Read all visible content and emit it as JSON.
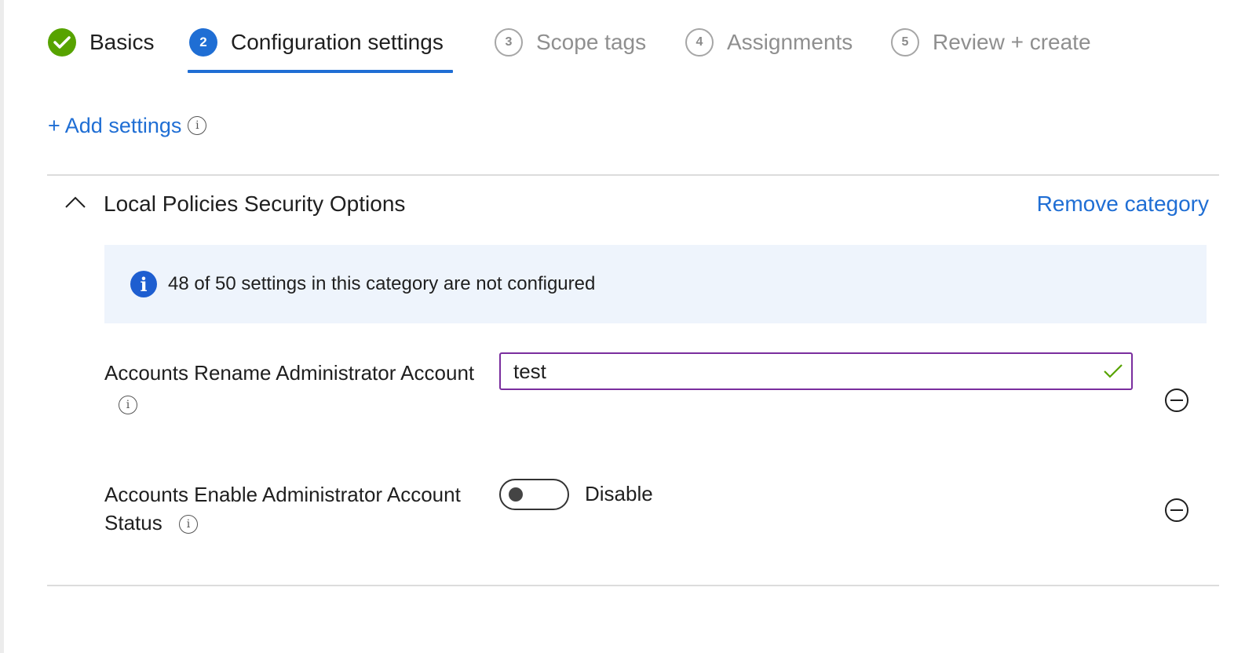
{
  "wizard": {
    "steps": [
      {
        "number": "",
        "label": "Basics",
        "state": "done"
      },
      {
        "number": "2",
        "label": "Configuration settings",
        "state": "active"
      },
      {
        "number": "3",
        "label": "Scope tags",
        "state": "inactive"
      },
      {
        "number": "4",
        "label": "Assignments",
        "state": "inactive"
      },
      {
        "number": "5",
        "label": "Review + create",
        "state": "inactive"
      }
    ]
  },
  "add_settings": {
    "label": "+ Add settings",
    "info_glyph": "i"
  },
  "category": {
    "title": "Local Policies Security Options",
    "remove_label": "Remove category",
    "expanded": true,
    "banner": {
      "icon": "i",
      "message": "48 of 50 settings in this category are not configured"
    }
  },
  "settings": [
    {
      "label": "Accounts Rename Administrator Account",
      "info_glyph": "i",
      "value": "test",
      "valid": true
    },
    {
      "label_line1": "Accounts Enable Administrator Account",
      "label_line2": "Status",
      "info_glyph": "i",
      "toggle_on": false,
      "toggle_label": "Disable"
    }
  ],
  "colors": {
    "accent": "#1f6ed4",
    "success": "#57a300",
    "input_border": "#7a2e9e",
    "banner_bg": "#eef4fc",
    "info_icon": "#1e5ed0"
  }
}
